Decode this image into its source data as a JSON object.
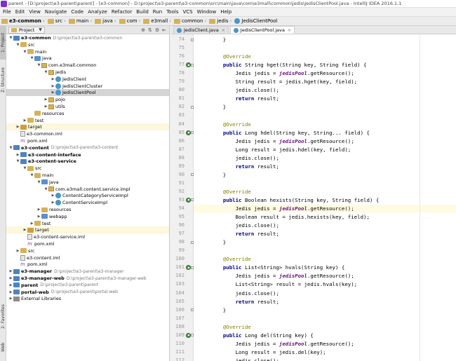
{
  "title_bar": {
    "text": "parent - [D:\\project\\e3-parent\\parent] - [e3-common] - D:\\project\\e3-parent\\e3-common\\src\\main\\java\\com\\e3mall\\common\\jedis\\JedisClientPool.java - IntelliJ IDEA 2016.1.1"
  },
  "menu": [
    "File",
    "Edit",
    "View",
    "Navigate",
    "Code",
    "Analyze",
    "Refactor",
    "Build",
    "Run",
    "Tools",
    "VCS",
    "Window",
    "Help"
  ],
  "breadcrumbs": [
    "e3-common",
    "src",
    "main",
    "java",
    "com",
    "e3mall",
    "common",
    "jedis",
    "JedisClientPool"
  ],
  "side_tabs": {
    "project": "1: Project",
    "structure": "Z: Structure",
    "favorites": "2: Favorites",
    "web": "Web"
  },
  "project_panel": {
    "selector": "Project"
  },
  "tree": [
    {
      "indent": 0,
      "arrow": "▼",
      "icon": "mod",
      "label": "e3-common",
      "bold": true,
      "path": "D:\\project\\e3-parent\\e3-common"
    },
    {
      "indent": 1,
      "arrow": "▼",
      "icon": "fold",
      "label": "src"
    },
    {
      "indent": 2,
      "arrow": "▼",
      "icon": "fold",
      "label": "main"
    },
    {
      "indent": 3,
      "arrow": "▼",
      "icon": "fold blue",
      "label": "java"
    },
    {
      "indent": 4,
      "arrow": "▼",
      "icon": "pkg",
      "label": "com.e3mall.common"
    },
    {
      "indent": 5,
      "arrow": "▼",
      "icon": "pkg",
      "label": "jedis"
    },
    {
      "indent": 6,
      "arrow": "▶",
      "icon": "cls",
      "label": "JedisClient"
    },
    {
      "indent": 6,
      "arrow": "▶",
      "icon": "cls",
      "label": "JedisClientCluster"
    },
    {
      "indent": 6,
      "arrow": "▶",
      "icon": "cls",
      "label": "JedisClientPool",
      "selected": true
    },
    {
      "indent": 5,
      "arrow": "▶",
      "icon": "pkg",
      "label": "pojo"
    },
    {
      "indent": 5,
      "arrow": "▶",
      "icon": "pkg",
      "label": "utils"
    },
    {
      "indent": 3,
      "arrow": "",
      "icon": "fold",
      "label": "resources"
    },
    {
      "indent": 2,
      "arrow": "▶",
      "icon": "fold",
      "label": "test"
    },
    {
      "indent": 1,
      "arrow": "▶",
      "icon": "fold orange",
      "label": "target",
      "hl": true
    },
    {
      "indent": 1,
      "arrow": "",
      "icon": "file",
      "label": "e3-common.iml"
    },
    {
      "indent": 1,
      "arrow": "",
      "icon": "m",
      "label": "pom.xml"
    },
    {
      "indent": 0,
      "arrow": "▼",
      "icon": "mod",
      "label": "e3-content",
      "bold": true,
      "path": "D:\\project\\e3-parent\\e3-content"
    },
    {
      "indent": 1,
      "arrow": "▶",
      "icon": "mod",
      "label": "e3-content-interface",
      "bold": true
    },
    {
      "indent": 1,
      "arrow": "▼",
      "icon": "mod",
      "label": "e3-content-service",
      "bold": true
    },
    {
      "indent": 2,
      "arrow": "▼",
      "icon": "fold",
      "label": "src"
    },
    {
      "indent": 3,
      "arrow": "▼",
      "icon": "fold",
      "label": "main"
    },
    {
      "indent": 4,
      "arrow": "▼",
      "icon": "fold blue",
      "label": "java"
    },
    {
      "indent": 5,
      "arrow": "▼",
      "icon": "pkg",
      "label": "com.e3mall.content.service.impl"
    },
    {
      "indent": 6,
      "arrow": "▶",
      "icon": "cls",
      "label": "ContentCategoryServiceImpl"
    },
    {
      "indent": 6,
      "arrow": "▶",
      "icon": "cls",
      "label": "ContentServiceImpl"
    },
    {
      "indent": 4,
      "arrow": "▶",
      "icon": "fold",
      "label": "resources"
    },
    {
      "indent": 4,
      "arrow": "▶",
      "icon": "fold blue",
      "label": "webapp"
    },
    {
      "indent": 3,
      "arrow": "▶",
      "icon": "fold",
      "label": "test"
    },
    {
      "indent": 2,
      "arrow": "▶",
      "icon": "fold orange",
      "label": "target",
      "hl": true
    },
    {
      "indent": 2,
      "arrow": "",
      "icon": "file",
      "label": "e3-content-service.iml"
    },
    {
      "indent": 2,
      "arrow": "",
      "icon": "m",
      "label": "pom.xml"
    },
    {
      "indent": 1,
      "arrow": "▶",
      "icon": "fold",
      "label": "src"
    },
    {
      "indent": 1,
      "arrow": "",
      "icon": "file",
      "label": "e3-content.iml"
    },
    {
      "indent": 1,
      "arrow": "",
      "icon": "m",
      "label": "pom.xml"
    },
    {
      "indent": 0,
      "arrow": "▶",
      "icon": "mod",
      "label": "e3-manager",
      "bold": true,
      "path": "D:\\project\\e3-parent\\e3-manager"
    },
    {
      "indent": 0,
      "arrow": "▶",
      "icon": "mod",
      "label": "e3-manager-web",
      "bold": true,
      "path": "D:\\project\\e3-parent\\e3-manager-web"
    },
    {
      "indent": 0,
      "arrow": "▶",
      "icon": "mod",
      "label": "parent",
      "bold": true,
      "path": "D:\\project\\e3-parent\\parent"
    },
    {
      "indent": 0,
      "arrow": "▶",
      "icon": "mod",
      "label": "portal-web",
      "bold": true,
      "path": "D:\\project\\e3-parent\\portal-web"
    },
    {
      "indent": 0,
      "arrow": "▶",
      "icon": "lib",
      "label": "External Libraries"
    }
  ],
  "tabs": [
    {
      "label": "JedisClient.java",
      "active": false
    },
    {
      "label": "JedisClientPool.java",
      "active": true
    }
  ],
  "code": [
    {
      "n": "74",
      "t": "    }"
    },
    {
      "n": "75",
      "t": ""
    },
    {
      "n": "76",
      "t": "    @Override"
    },
    {
      "n": "77",
      "t": "    public String hget(String key, String field) {",
      "mark": true
    },
    {
      "n": "78",
      "t": "        Jedis jedis = jedisPool.getResource();"
    },
    {
      "n": "79",
      "t": "        String result = jedis.hget(key, field);"
    },
    {
      "n": "80",
      "t": "        jedis.close();"
    },
    {
      "n": "81",
      "t": "        return result;"
    },
    {
      "n": "82",
      "t": "    }"
    },
    {
      "n": "83",
      "t": ""
    },
    {
      "n": "84",
      "t": "    @Override"
    },
    {
      "n": "85",
      "t": "    public Long hdel(String key, String... field) {",
      "mark": true
    },
    {
      "n": "86",
      "t": "        Jedis jedis = jedisPool.getResource();"
    },
    {
      "n": "87",
      "t": "        Long result = jedis.hdel(key, field);"
    },
    {
      "n": "88",
      "t": "        jedis.close();"
    },
    {
      "n": "89",
      "t": "        return result;"
    },
    {
      "n": "90",
      "t": "    }"
    },
    {
      "n": "91",
      "t": ""
    },
    {
      "n": "92",
      "t": "    @Override"
    },
    {
      "n": "93",
      "t": "    public Boolean hexists(String key, String field) {",
      "mark": true
    },
    {
      "n": "94",
      "t": "        Jedis jedis = jedisPool.getResource();",
      "cur": true
    },
    {
      "n": "95",
      "t": "        Boolean result = jedis.hexists(key, field);"
    },
    {
      "n": "96",
      "t": "        jedis.close();"
    },
    {
      "n": "97",
      "t": "        return result;"
    },
    {
      "n": "98",
      "t": "    }"
    },
    {
      "n": "99",
      "t": ""
    },
    {
      "n": "100",
      "t": "    @Override"
    },
    {
      "n": "101",
      "t": "    public List<String> hvals(String key) {",
      "mark": true
    },
    {
      "n": "102",
      "t": "        Jedis jedis = jedisPool.getResource();"
    },
    {
      "n": "103",
      "t": "        List<String> result = jedis.hvals(key);"
    },
    {
      "n": "104",
      "t": "        jedis.close();"
    },
    {
      "n": "105",
      "t": "        return result;"
    },
    {
      "n": "106",
      "t": "    }"
    },
    {
      "n": "107",
      "t": ""
    },
    {
      "n": "108",
      "t": "    @Override"
    },
    {
      "n": "109",
      "t": "    public Long del(String key) {",
      "mark": true
    },
    {
      "n": "110",
      "t": "        Jedis jedis = jedisPool.getResource();"
    },
    {
      "n": "111",
      "t": "        Long result = jedis.del(key);"
    },
    {
      "n": "112",
      "t": "        jedis.close();"
    }
  ]
}
